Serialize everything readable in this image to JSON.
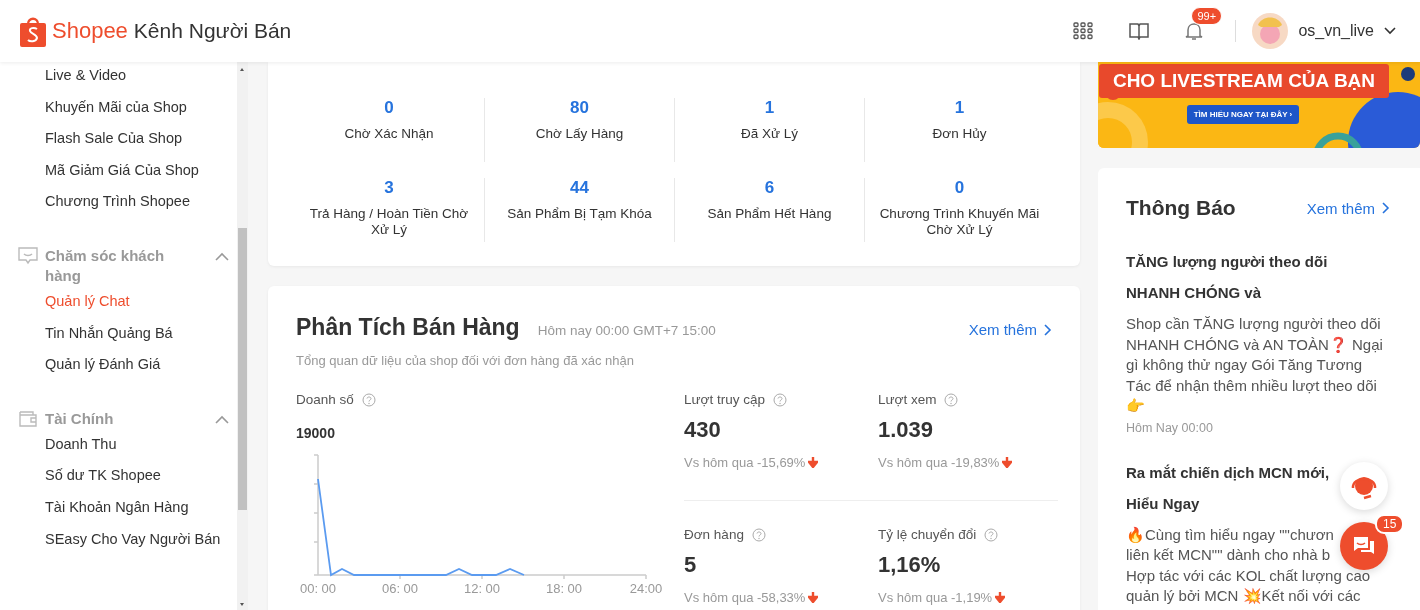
{
  "header": {
    "brand": "Shopee",
    "title": "Kênh Người Bán",
    "notification_badge": "99+",
    "username": "os_vn_live"
  },
  "sidebar": {
    "groups": [
      {
        "items": [
          {
            "label": "Live & Video",
            "selected": false
          },
          {
            "label": "Khuyến Mãi của Shop",
            "selected": false
          },
          {
            "label": "Flash Sale Của Shop",
            "selected": false
          },
          {
            "label": "Mã Giảm Giá Của Shop",
            "selected": false
          },
          {
            "label": "Chương Trình Shopee",
            "selected": false
          }
        ]
      },
      {
        "title": "Chăm sóc khách hàng",
        "expanded": true,
        "items": [
          {
            "label": "Quản lý Chat",
            "selected": true
          },
          {
            "label": "Tin Nhắn Quảng Bá",
            "selected": false
          },
          {
            "label": "Quản lý Đánh Giá",
            "selected": false
          }
        ]
      },
      {
        "title": "Tài Chính",
        "expanded": true,
        "items": [
          {
            "label": "Doanh Thu",
            "selected": false
          },
          {
            "label": "Số dư TK Shopee",
            "selected": false
          },
          {
            "label": "Tài Khoản Ngân Hàng",
            "selected": false
          },
          {
            "label": "SEasy Cho Vay Người Bán",
            "selected": false
          }
        ]
      }
    ]
  },
  "order_stats": [
    {
      "value": "0",
      "label": "Chờ Xác Nhận"
    },
    {
      "value": "80",
      "label": "Chờ Lấy Hàng"
    },
    {
      "value": "1",
      "label": "Đã Xử Lý"
    },
    {
      "value": "1",
      "label": "Đơn Hủy"
    },
    {
      "value": "3",
      "label": "Trả Hàng / Hoàn Tiền Chờ Xử Lý"
    },
    {
      "value": "44",
      "label": "Sản Phẩm Bị Tạm Khóa"
    },
    {
      "value": "6",
      "label": "Sản Phẩm Hết Hàng"
    },
    {
      "value": "0",
      "label": "Chương Trình Khuyến Mãi Chờ Xử Lý"
    }
  ],
  "sales_analysis": {
    "title": "Phân Tích Bán Hàng",
    "time": "Hôm nay 00:00 GMT+7 15:00",
    "link": "Xem thêm",
    "subtitle": "Tổng quan dữ liệu của shop đối với đơn hàng đã xác nhận",
    "revenue": {
      "label": "Doanh số",
      "value": "19000",
      "x_labels": [
        "00: 00",
        "06: 00",
        "12: 00",
        "18: 00",
        "24:00"
      ]
    },
    "metrics": [
      {
        "label": "Lượt truy cập",
        "value": "430",
        "change": "Vs hôm qua -15,69%"
      },
      {
        "label": "Lượt xem",
        "value": "1.039",
        "change": "Vs hôm qua -19,83%"
      },
      {
        "label": "Đơn hàng",
        "value": "5",
        "change": "Vs hôm qua -58,33%"
      },
      {
        "label": "Tỷ lệ chuyển đổi",
        "value": "1,16%",
        "change": "Vs hôm qua -1,19%"
      }
    ]
  },
  "banner": {
    "headline": "CHO LIVESTREAM CỦA BẠN",
    "button": "TÌM HIỂU NGAY TẠI ĐÂY ›"
  },
  "notifications": {
    "title": "Thông Báo",
    "link": "Xem thêm",
    "items": [
      {
        "title": "TĂNG lượng người theo dõi NHANH CHÓNG và",
        "body": "Shop cần TĂNG lượng người theo dõi NHANH CHÓNG và AN TOÀN❓ Ngại gì không thử ngay Gói Tăng Tương Tác để nhận thêm nhiều lượt theo dõi 👉",
        "time": "Hôm Nay 00:00"
      },
      {
        "title": "Ra mắt chiến dịch MCN mới, Hiểu Ngay",
        "lines": [
          "🔥Cùng tìm hiểu ngay \"\"chươn",
          "liên kết MCN\"\" dành cho nhà b",
          "Hợp tác với các KOL chất lượng cao",
          "quản lý bởi MCN 💥Kết nối với các"
        ]
      }
    ]
  },
  "chat_badge": "15"
}
